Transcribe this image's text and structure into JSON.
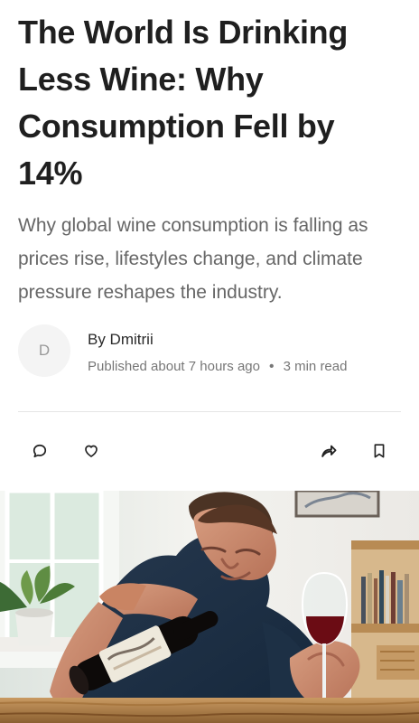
{
  "article": {
    "title": "The World Is Drinking Less Wine: Why Consumption Fell by 14%",
    "subtitle": "Why global wine consumption is falling as prices rise, lifestyles change, and climate pressure reshapes the industry.",
    "author": {
      "initial": "D",
      "byline": "By Dmitrii",
      "published": "Published about 7 hours ago",
      "read_time": "3 min read"
    }
  },
  "actions": {
    "comment_icon": "comment-icon",
    "like_icon": "heart-icon",
    "share_icon": "share-icon",
    "bookmark_icon": "bookmark-icon"
  },
  "colors": {
    "title": "#1f1f1f",
    "subtitle": "#666666",
    "meta": "#777777",
    "divider": "#e6e6e6",
    "avatar_bg": "#f4f4f4"
  }
}
